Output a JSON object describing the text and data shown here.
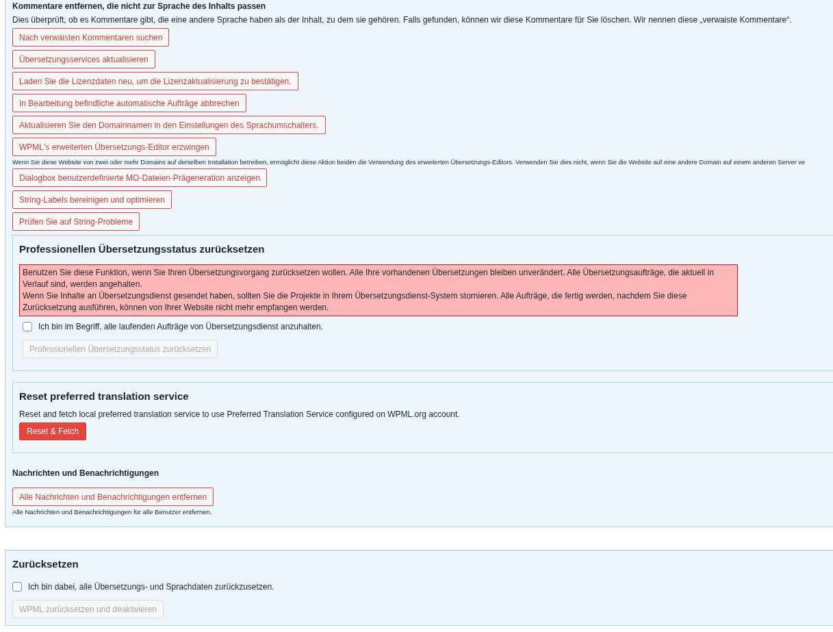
{
  "tools_panel": {
    "heading": "Kommentare entfernen, die nicht zur Sprache des Inhalts passen",
    "description": "Dies überprüft, ob es Kommentare gibt, die eine andere Sprache haben als der Inhalt, zu dem sie gehören. Falls gefunden, können wir diese Kommentare für Sie löschen. Wir nennen diese „verwaiste Kommentare“.",
    "actions": [
      {
        "label": "Nach verwaisten Kommentaren suchen"
      },
      {
        "label": "Übersetzungsservices aktualisieren"
      },
      {
        "label": "Laden Sie die Lizenzdaten neu, um die Lizenzaktualisierung zu bestätigen."
      },
      {
        "label": "In Bearbeitung befindliche automatische Aufträge abbrechen"
      },
      {
        "label": "Aktualisieren Sie den Domainnamen in den Einstellungen des Sprachumschalters."
      },
      {
        "label": "WPML's erweiterten Übersetzungs-Editor erzwingen",
        "hint": "Wenn Sie diese Website von zwei oder mehr Domains auf derselben Installation betreiben, ermöglicht diese Aktion beiden die Verwendung des erweiterten Übersetzungs-Editors. Verwenden Sie dies nicht, wenn Sie die Website auf eine andere Domain auf einem anderen Server ve"
      },
      {
        "label": "Dialogbox benutzerdefinierte MO-Dateien-Prägeneration anzeigen"
      },
      {
        "label": "String-Labels bereinigen und optimieren"
      },
      {
        "label": "Prüfen Sie auf String-Probleme"
      }
    ],
    "subpanels": [
      {
        "kind": "reset",
        "title": "Professionellen Übersetzungsstatus zurücksetzen",
        "warning": [
          "Benutzen Sie diese Funktion, wenn Sie Ihren Übersetzungsvorgang zurücksetzen wollen. Alle Ihre vorhandenen Übersetzungen bleiben unverändert. Alle Übersetzungsaufträge, die aktuell in Verlauf sind, werden angehalten.",
          "Wenn Sie Inhalte an Übersetzungsdienst gesendet haben, sollten Sie die Projekte in Ihrem Übersetzungsdienst-System stornieren. Alle Aufträge, die fertig werden, nachdem Sie diese Zurücksetzung ausführen, können von Ihrer Website nicht mehr empfangen werden."
        ],
        "checkbox": {
          "label": "Ich bin im Begriff, alle laufenden Aufträge von Übersetzungsdienst anzuhalten.",
          "checked": false
        },
        "button": {
          "label": "Professionellen Übersetzungsstatus zurücksetzen",
          "disabled": true
        }
      },
      {
        "kind": "fetch",
        "title": "Reset preferred translation service",
        "description": "Reset and fetch local preferred translation service to use Preferred Translation Service configured on WPML.org account.",
        "button": {
          "label": "Reset & Fetch",
          "disabled": false
        }
      }
    ],
    "notifications": {
      "heading": "Nachrichten und Benachrichtigungen",
      "button": "Alle Nachrichten und Benachrichtigungen entfernen",
      "hint": "Alle Nachrichten und Benachrichtigungen für alle Benutzer entfernen."
    }
  },
  "reset_panel": {
    "title": "Zurücksetzen",
    "checkbox": {
      "label": "Ich bin dabei, alle Übersetzungs- und Sprachdaten zurückzusetzen.",
      "checked": false
    },
    "button": {
      "label": "WPML zurücksetzen und deaktivieren",
      "disabled": true
    }
  }
}
